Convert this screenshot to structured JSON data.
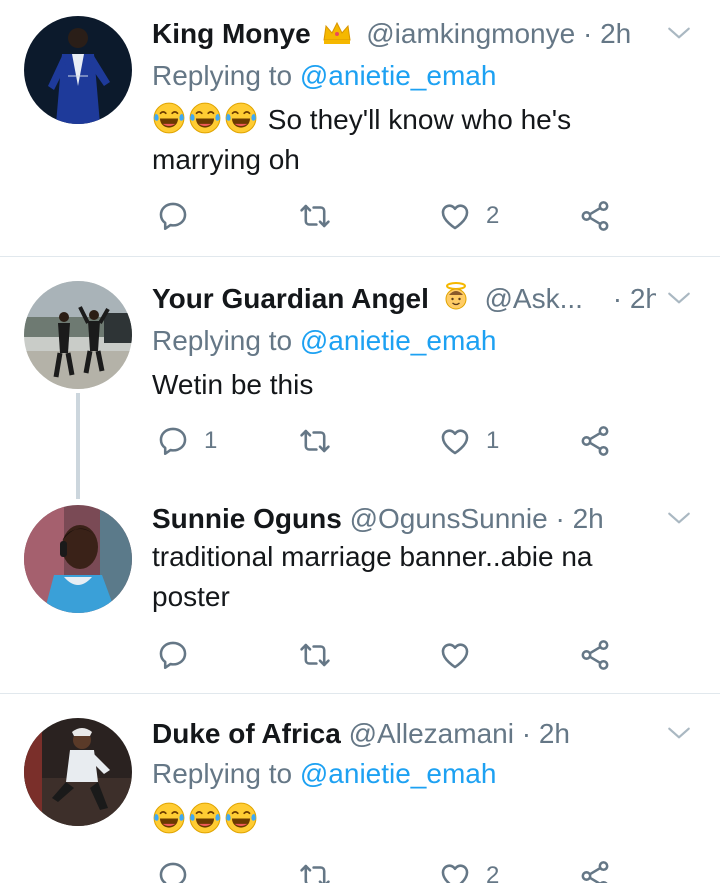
{
  "colors": {
    "link": "#1da1f2",
    "secondary": "#657786",
    "divider": "#e1e8ed",
    "thread": "#ccd6dd"
  },
  "tweets": [
    {
      "name": "King Monye",
      "badge": "crown-emoji",
      "handle": "@iamkingmonye",
      "dot": "·",
      "time": "2h",
      "replying_prefix": "Replying to",
      "replying_to": "@anietie_emah",
      "emojis": [
        "face-with-tears-of-joy-emoji",
        "face-with-tears-of-joy-emoji",
        "face-with-tears-of-joy-emoji"
      ],
      "text": "So they'll know who he's marrying oh",
      "reply_count": "",
      "retweet_count": "",
      "like_count": "2"
    },
    {
      "name": "Your Guardian Angel",
      "badge": "angel-emoji",
      "handle": "@Ask...",
      "dot": "·",
      "time": "2h",
      "replying_prefix": "Replying to",
      "replying_to": "@anietie_emah",
      "text": "Wetin be this",
      "reply_count": "1",
      "retweet_count": "",
      "like_count": "1"
    },
    {
      "name": "Sunnie Oguns",
      "handle": "@OgunsSunnie",
      "dot": "·",
      "time": "2h",
      "text": "traditional marriage banner..abie na poster",
      "reply_count": "",
      "retweet_count": "",
      "like_count": ""
    },
    {
      "name": "Duke of Africa",
      "handle": "@Allezamani",
      "dot": "·",
      "time": "2h",
      "replying_prefix": "Replying to",
      "replying_to": "@anietie_emah",
      "emojis": [
        "face-with-tears-of-joy-emoji",
        "face-with-tears-of-joy-emoji",
        "face-with-tears-of-joy-emoji"
      ],
      "reply_count": "",
      "retweet_count": "",
      "like_count": "2"
    }
  ]
}
